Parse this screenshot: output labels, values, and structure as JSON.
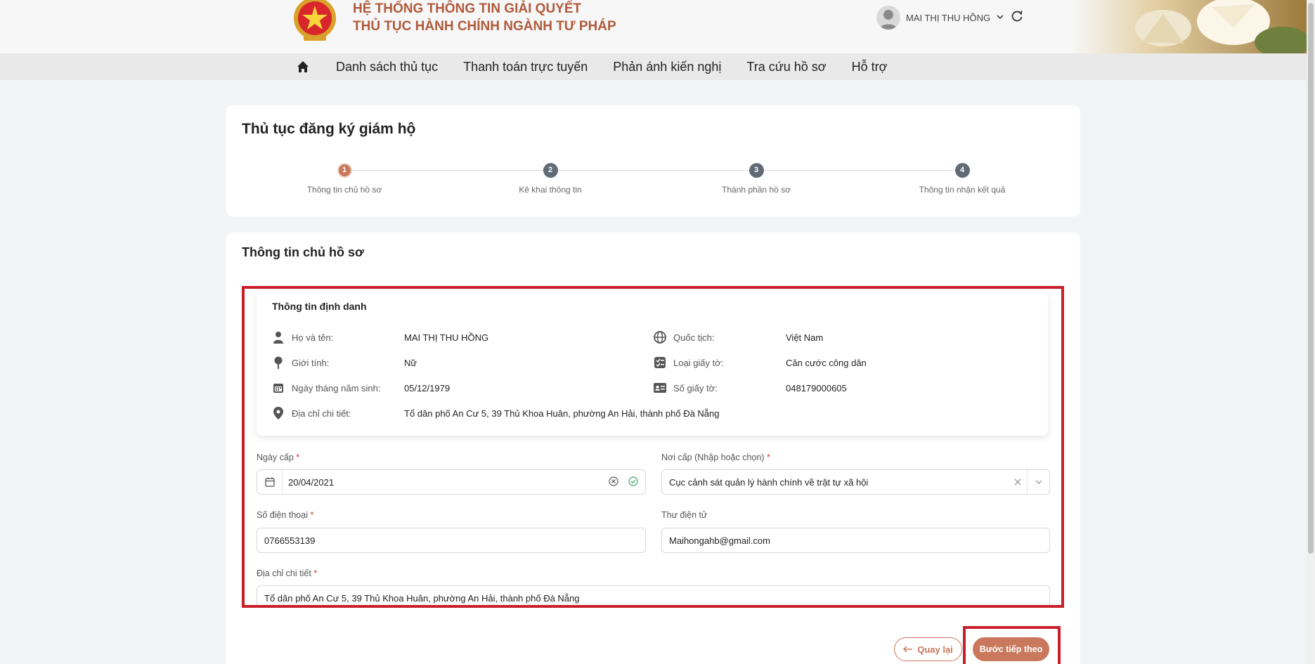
{
  "header": {
    "brand_line1": "HỆ THỐNG THÔNG TIN GIẢI QUYẾT",
    "brand_line2": "THỦ TỤC HÀNH CHÍNH NGÀNH TƯ PHÁP",
    "user_name": "MAI THỊ THU HỒNG"
  },
  "nav": {
    "items": [
      "Danh sách thủ tục",
      "Thanh toán trực tuyến",
      "Phản ánh kiến nghị",
      "Tra cứu hồ sơ",
      "Hỗ trợ"
    ]
  },
  "procedure": {
    "title": "Thủ tục đăng ký giám hộ",
    "steps": [
      {
        "num": "1",
        "label": "Thông tin chủ hồ sơ"
      },
      {
        "num": "2",
        "label": "Kê khai thông tin"
      },
      {
        "num": "3",
        "label": "Thành phần hồ sơ"
      },
      {
        "num": "4",
        "label": "Thông tin nhận kết quả"
      }
    ]
  },
  "owner": {
    "section_title": "Thông tin chủ hồ sơ",
    "id_box_title": "Thông tin định danh",
    "fields": {
      "name_label": "Họ và tên:",
      "name_value": "MAI THỊ THU HỒNG",
      "nationality_label": "Quốc tịch:",
      "nationality_value": "Việt Nam",
      "gender_label": "Giới tính:",
      "gender_value": "Nữ",
      "doctype_label": "Loại giấy tờ:",
      "doctype_value": "Căn cước công dân",
      "dob_label": "Ngày tháng năm sinh:",
      "dob_value": "05/12/1979",
      "docno_label": "Số giấy tờ:",
      "docno_value": "048179000605",
      "address_label": "Địa chỉ chi tiết:",
      "address_value": "Tổ dân phố An Cư 5, 39 Thủ Khoa Huân, phường An Hải, thành phố Đà Nẵng"
    }
  },
  "form": {
    "issue_date_label": "Ngày cấp",
    "issue_date_value": "20/04/2021",
    "issue_place_label": "Nơi cấp (Nhập hoặc chọn)",
    "issue_place_value": "Cục cảnh sát quản lý hành chính về trật tự xã hội",
    "phone_label": "Số điện thoại",
    "phone_value": "0766553139",
    "email_label": "Thư điện tử",
    "email_value": "Maihongahb@gmail.com",
    "address_label": "Địa chỉ chi tiết",
    "address_value": "Tổ dân phố An Cư 5, 39 Thủ Khoa Huân, phường An Hải, thành phố Đà Nẵng",
    "required_mark": "*"
  },
  "actions": {
    "back_label": "Quay lại",
    "next_label": "Bước tiếp theo"
  },
  "colors": {
    "accent": "#c9785b",
    "brand_text": "#b05a3c",
    "highlight": "#c8202a"
  }
}
